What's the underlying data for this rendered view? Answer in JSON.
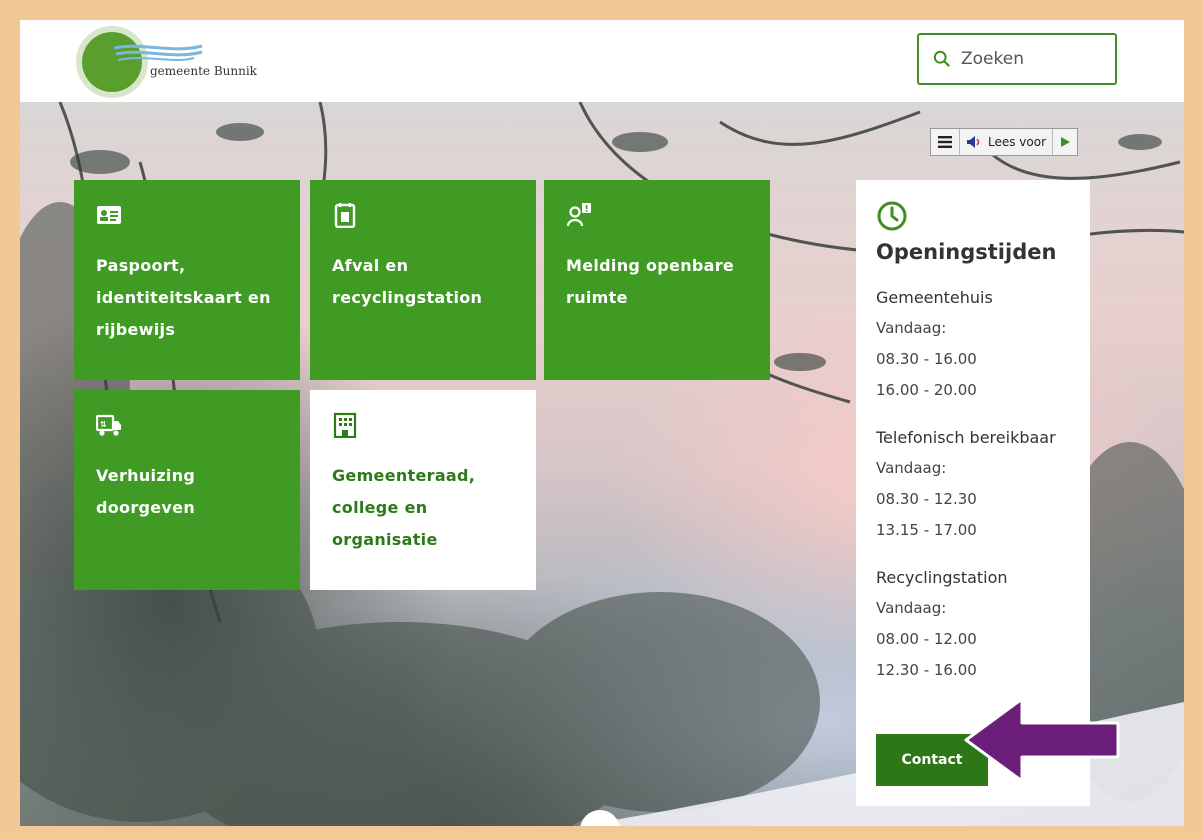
{
  "header": {
    "logo_text": "gemeente Bunnik",
    "search_placeholder": "Zoeken"
  },
  "readspeaker": {
    "menu_icon": "menu-icon",
    "listen_label": "Lees voor",
    "play_icon": "play-icon"
  },
  "tiles": [
    {
      "label": "Paspoort, identiteitskaart en rijbewijs",
      "icon": "id-card-icon"
    },
    {
      "label": "Afval en recyclingstation",
      "icon": "waste-bin-icon"
    },
    {
      "label": "Melding openbare ruimte",
      "icon": "report-person-icon"
    },
    {
      "label": "Verhuizing doorgeven",
      "icon": "moving-truck-icon"
    },
    {
      "label": "Gemeenteraad, college en organisatie",
      "icon": "building-icon"
    }
  ],
  "hours": {
    "title": "Openingstijden",
    "locations": [
      {
        "name": "Gemeentehuis",
        "day": "Vandaag:",
        "times": [
          "08.30 - 16.00",
          "16.00 - 20.00"
        ]
      },
      {
        "name": "Telefonisch bereikbaar",
        "day": "Vandaag:",
        "times": [
          "08.30 - 12.30",
          "13.15 - 17.00"
        ]
      },
      {
        "name": "Recyclingstation",
        "day": "Vandaag:",
        "times": [
          "08.00 - 12.00",
          "12.30 - 16.00"
        ]
      }
    ],
    "contact_label": "Contact"
  },
  "colors": {
    "brand_green": "#3f9b24",
    "dark_green": "#2d7716",
    "annotation_arrow": "#6b1f7a",
    "frame": "#f2c894"
  }
}
